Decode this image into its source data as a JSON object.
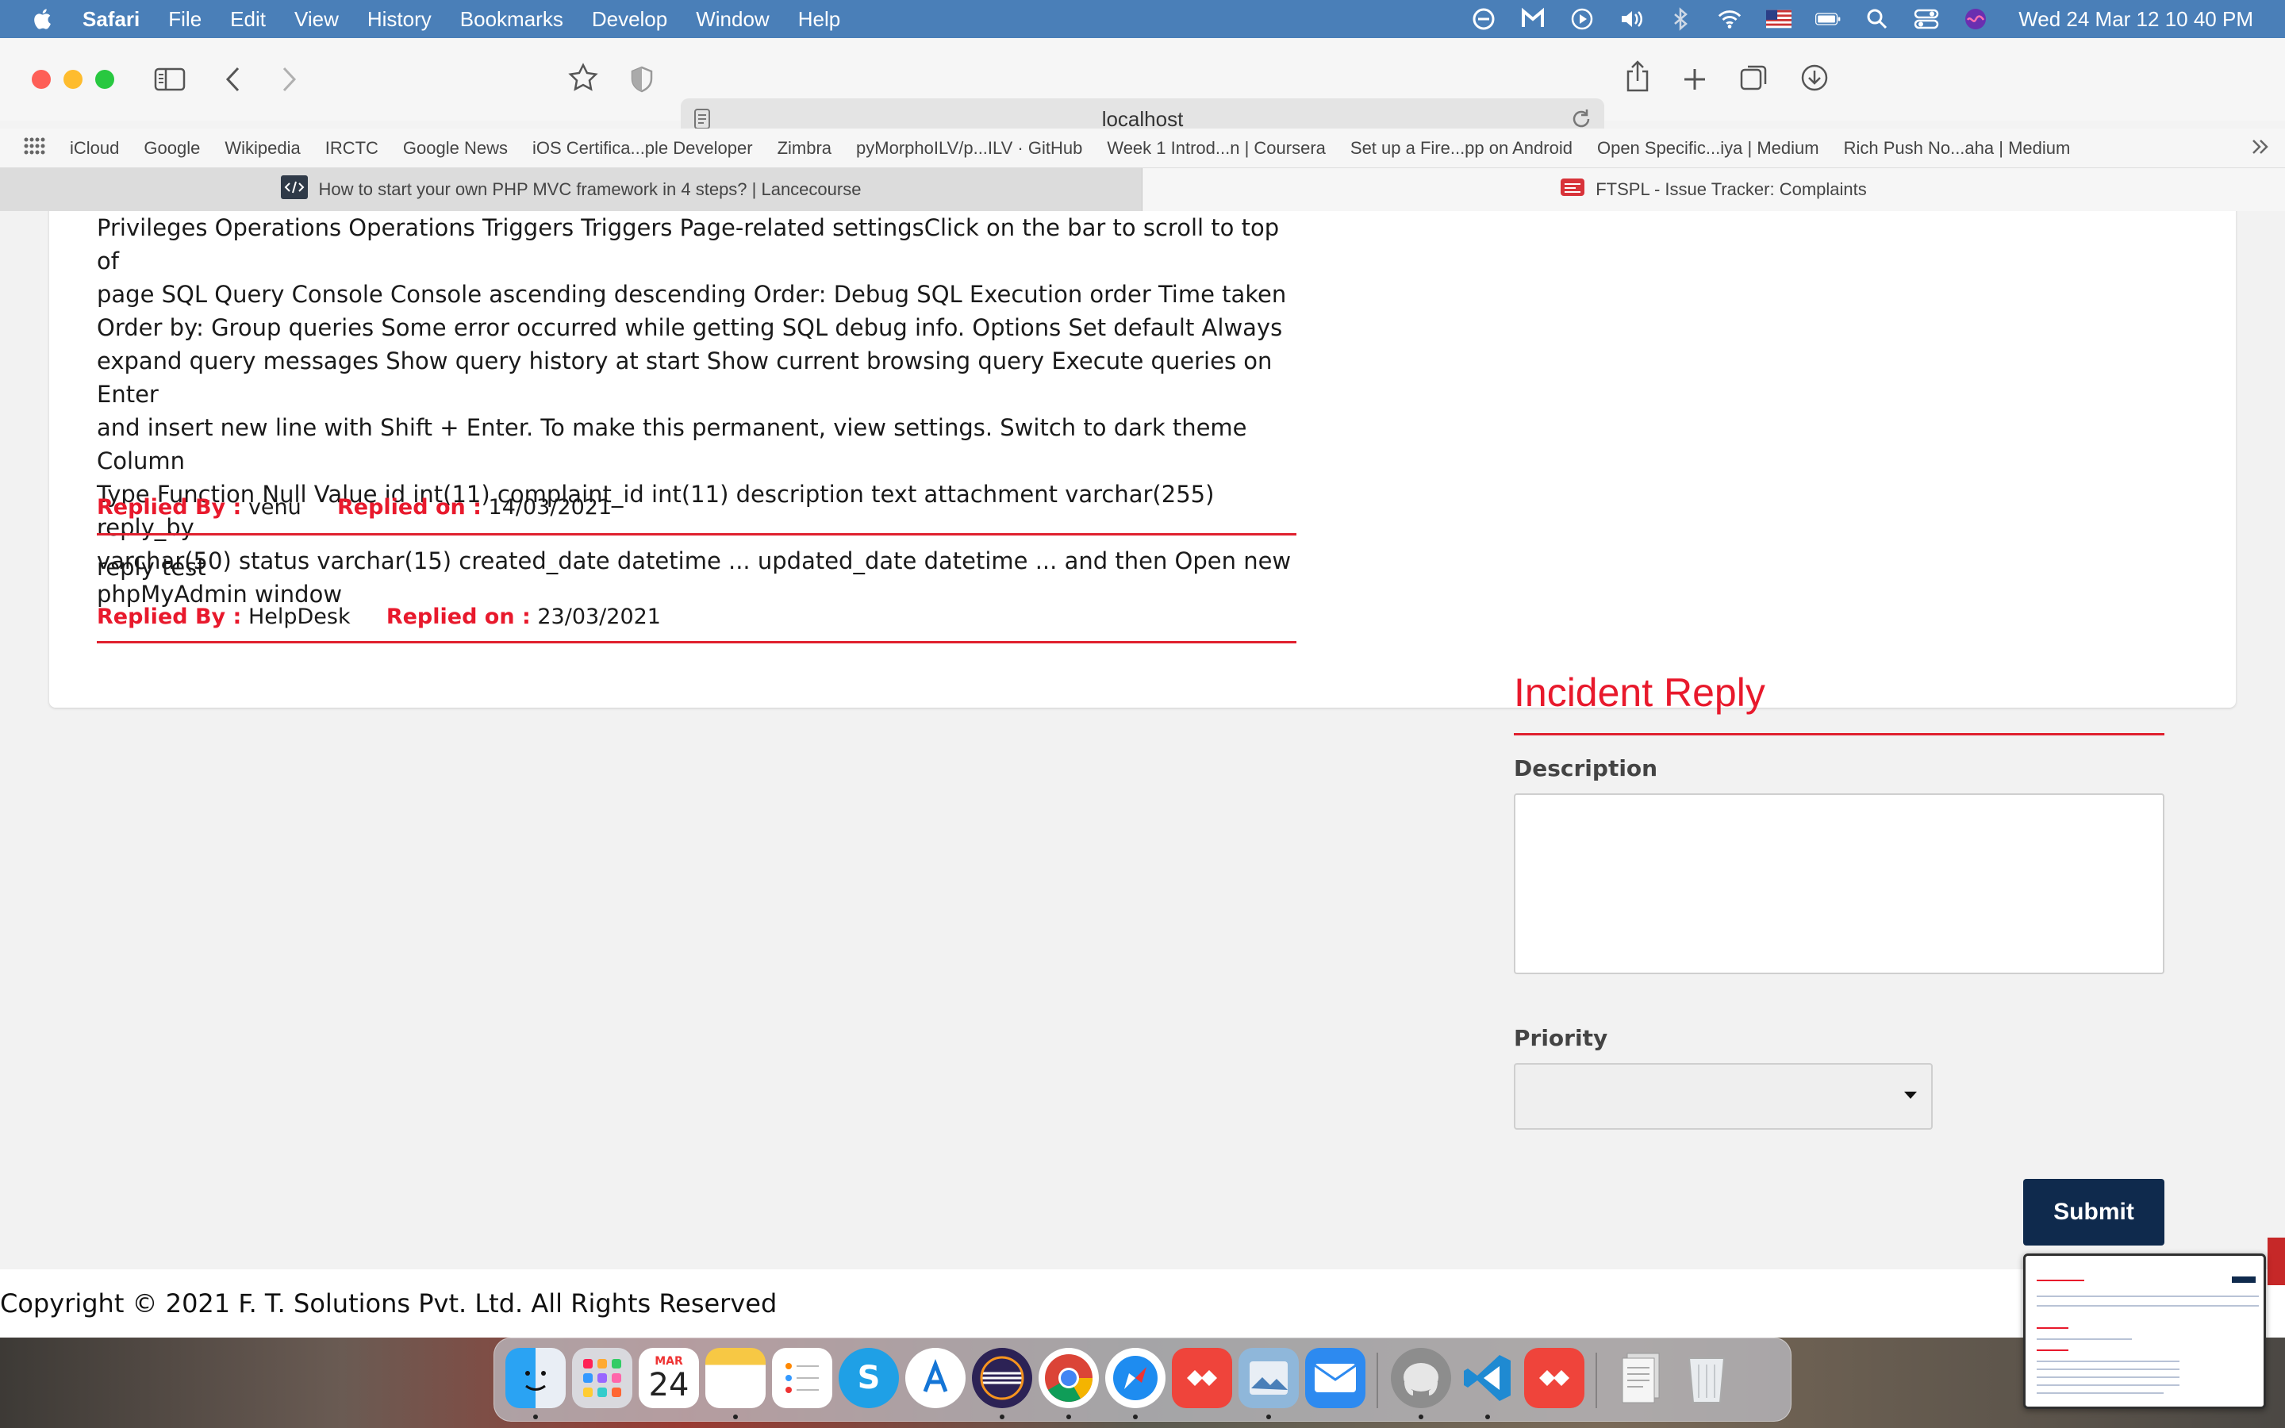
{
  "menubar": {
    "app_name": "Safari",
    "menus": [
      "File",
      "Edit",
      "View",
      "History",
      "Bookmarks",
      "Develop",
      "Window",
      "Help"
    ],
    "clock": "Wed 24 Mar  12 10 40 PM"
  },
  "browser": {
    "url": "localhost",
    "bookmarks": [
      "iCloud",
      "Google",
      "Wikipedia",
      "IRCTC",
      "Google News",
      "iOS Certifica...ple Developer",
      "Zimbra",
      "pyMorphoILV/p...ILV · GitHub",
      "Week 1 Introd...n | Coursera",
      "Set up a Fire...pp on Android",
      "Open Specific...iya | Medium",
      "Rich Push No...aha | Medium"
    ],
    "tabs": [
      {
        "title": "How to start your own PHP MVC framework in 4 steps? | Lancecourse",
        "favicon": "code-icon",
        "active": false
      },
      {
        "title": "FTSPL - Issue Tracker: Complaints",
        "favicon": "ftspl-logo-icon",
        "active": true
      }
    ]
  },
  "replies": {
    "first_text_lines": [
      "Privileges Operations Operations Triggers Triggers Page-related settingsClick on the bar to scroll to top of",
      "page SQL Query Console Console ascending descending Order: Debug SQL Execution order Time taken",
      "Order by: Group queries Some error occurred while getting SQL debug info. Options Set default Always",
      "expand query messages Show query history at start Show current browsing query Execute queries on Enter",
      "and insert new line with Shift + Enter. To make this permanent, view settings. Switch to dark theme Column",
      "Type Function Null Value id int(11) complaint_id int(11) description text attachment varchar(255) reply_by",
      "varchar(50) status varchar(15) created_date datetime ... updated_date datetime ... and then Open new",
      "phpMyAdmin window"
    ],
    "replied_by_label": "Replied By :",
    "replied_on_label": "Replied on :",
    "first_by": "venu",
    "first_on": "14/03/2021",
    "second_text": "reply test",
    "second_by": "HelpDesk",
    "second_on": "23/03/2021"
  },
  "form": {
    "title": "Incident Reply",
    "description_label": "Description",
    "description_value": "",
    "priority_label": "Priority",
    "priority_value": "",
    "submit_label": "Submit"
  },
  "footer": {
    "copyright": "Copyright © 2021 F. T. Solutions Pvt. Ltd. All Rights Reserved"
  },
  "dock": {
    "calendar_month": "MAR",
    "calendar_day": "24",
    "apps": [
      "finder-icon",
      "launchpad-icon",
      "calendar-icon",
      "notes-icon",
      "reminders-icon",
      "skype-icon",
      "xcode-icon",
      "eclipse-icon",
      "chrome-icon",
      "safari-icon",
      "anydesk-icon",
      "preview-icon",
      "mail-icon",
      "sequel-pro-icon",
      "vscode-icon",
      "anydesk-icon",
      "documents-icon",
      "trash-icon"
    ]
  },
  "colors": {
    "accent_red": "#e8192c",
    "submit_navy": "#0f2a4d",
    "menubar_blue": "#4a7fb8"
  }
}
